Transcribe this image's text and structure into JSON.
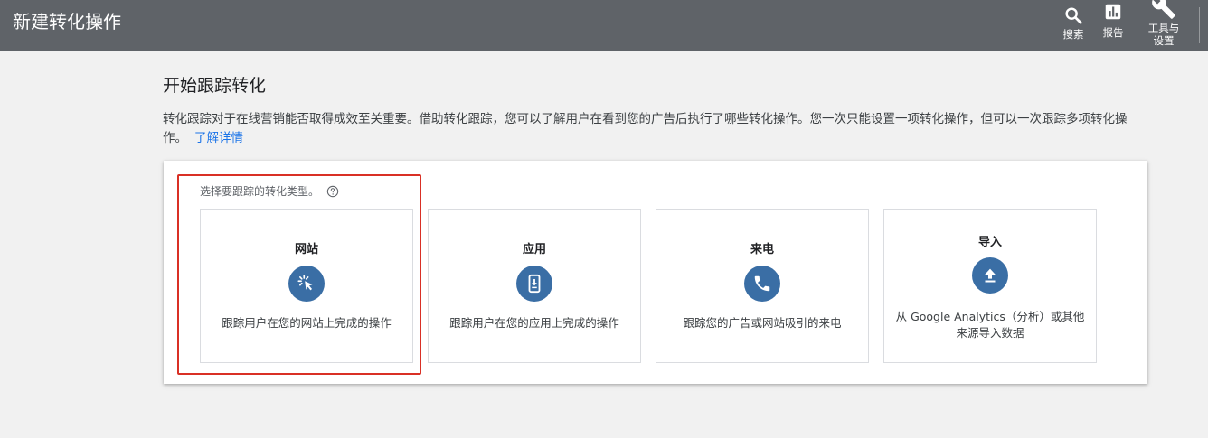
{
  "header": {
    "title": "新建转化操作",
    "search_label": "搜索",
    "reports_label": "报告",
    "settings_label": "工具与设置"
  },
  "main": {
    "heading": "开始跟踪转化",
    "intro_text": "转化跟踪对于在线营销能否取得成效至关重要。借助转化跟踪，您可以了解用户在看到您的广告后执行了哪些转化操作。您一次只能设置一项转化操作，但可以一次跟踪多项转化操作。",
    "learn_more": "了解详情",
    "prompt": "选择要跟踪的转化类型。",
    "options": [
      {
        "title": "网站",
        "icon": "cursor-click-icon",
        "description": "跟踪用户在您的网站上完成的操作"
      },
      {
        "title": "应用",
        "icon": "phone-download-icon",
        "description": "跟踪用户在您的应用上完成的操作"
      },
      {
        "title": "来电",
        "icon": "phone-call-icon",
        "description": "跟踪您的广告或网站吸引的来电"
      },
      {
        "title": "导入",
        "icon": "upload-icon",
        "description": "从 Google Analytics（分析）或其他来源导入数据"
      }
    ]
  },
  "colors": {
    "topbar": "#5f6368",
    "accent_icon": "#3a6ea5",
    "highlight": "#d93025",
    "link": "#1a73e8"
  }
}
